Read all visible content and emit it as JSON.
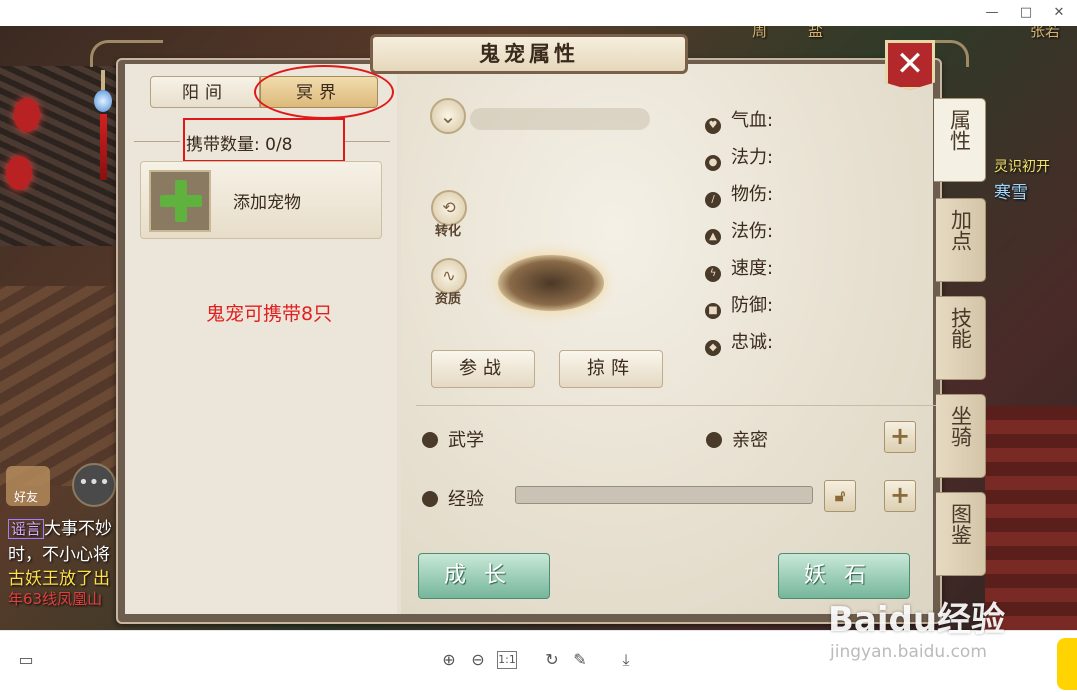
{
  "window": {
    "min": "—",
    "max": "□",
    "close": "✕"
  },
  "scene": {
    "top_chat": [
      {
        "text": "周",
        "color": "#d4b070"
      },
      {
        "text": "盐",
        "color": "#d4b070"
      },
      {
        "text": "张若",
        "color": "#d4b070"
      }
    ],
    "right_chat": [
      {
        "text": "灵识初开",
        "color": "#f2e36a"
      },
      {
        "text": "寒雪",
        "color": "#9fd8ff"
      }
    ],
    "friend_label": "好友",
    "chat_lines": [
      {
        "tag": "谣言",
        "text": "大事不妙"
      },
      {
        "tag": "",
        "text": "时，不小心将"
      },
      {
        "tag": "",
        "text": "古妖王放了出"
      },
      {
        "tag": "",
        "text": "年63线凤凰山"
      }
    ]
  },
  "panel": {
    "title": "鬼宠属性",
    "close_label": "✕",
    "tabs": {
      "yang": "阳间",
      "ming": "冥界"
    },
    "carry_count": "携带数量: 0/8",
    "add_pet": "添加宠物",
    "note": "鬼宠可携带8只",
    "icons": {
      "convert": "转化",
      "aptitude": "资质"
    },
    "stats": [
      "气血:",
      "法力:",
      "物伤:",
      "法伤:",
      "速度:",
      "防御:",
      "忠诚:"
    ],
    "buttons": {
      "join_battle": "参战",
      "formation": "掠阵",
      "grow": "成长",
      "demon_stone": "妖石"
    },
    "martial": "武学",
    "intimacy": "亲密",
    "experience": "经验",
    "experience_fraction": 0.0,
    "side_tabs": [
      "属性",
      "加点",
      "技能",
      "坐骑",
      "图鉴"
    ]
  },
  "watermark": {
    "main": "Baidu经验",
    "sub": "jingyan.baidu.com"
  },
  "toolbar": {
    "zoom_in": "⊕",
    "zoom_out": "⊖",
    "actual": "1:1",
    "rotate": "↻",
    "edit": "✎",
    "download": "⤓"
  }
}
